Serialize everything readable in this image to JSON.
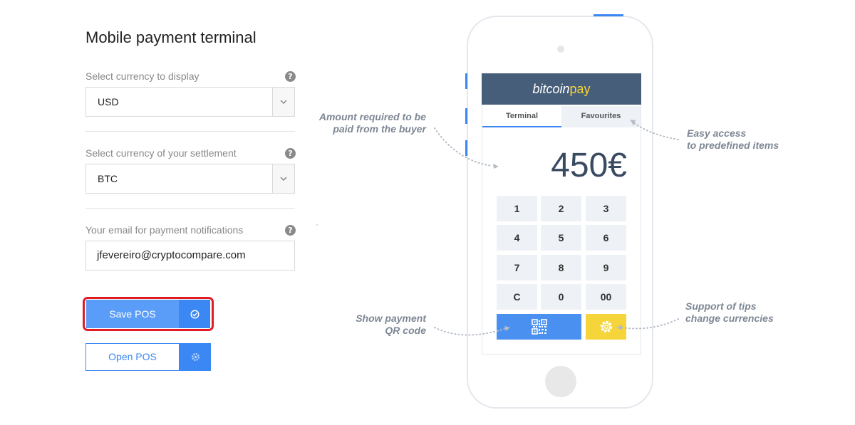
{
  "page_title": "Mobile payment terminal",
  "form": {
    "display_currency": {
      "label": "Select currency to display",
      "value": "USD"
    },
    "settlement_currency": {
      "label": "Select currency of your settlement",
      "value": "BTC"
    },
    "email": {
      "label": "Your email for payment notifications",
      "value": "jfevereiro@cryptocompare.com"
    },
    "help_glyph": "?"
  },
  "buttons": {
    "save_label": "Save POS",
    "open_label": "Open POS"
  },
  "phone": {
    "brand": {
      "word": "bitcoin",
      "suffix": "pay"
    },
    "tabs": [
      "Terminal",
      "Favourites"
    ],
    "amount": "450€",
    "keypad": [
      "1",
      "2",
      "3",
      "4",
      "5",
      "6",
      "7",
      "8",
      "9",
      "C",
      "0",
      "00"
    ]
  },
  "callouts": {
    "amount": [
      "Amount required to be",
      "paid from the buyer"
    ],
    "favourites": [
      "Easy access",
      "to predefined items"
    ],
    "qr": [
      "Show payment",
      "QR code"
    ],
    "tips": [
      "Support of tips",
      "change currencies"
    ]
  },
  "colors": {
    "accent": "#3b87f3",
    "highlight": "#e11d22",
    "header": "#475e7a",
    "gear_key": "#f5d53a"
  }
}
